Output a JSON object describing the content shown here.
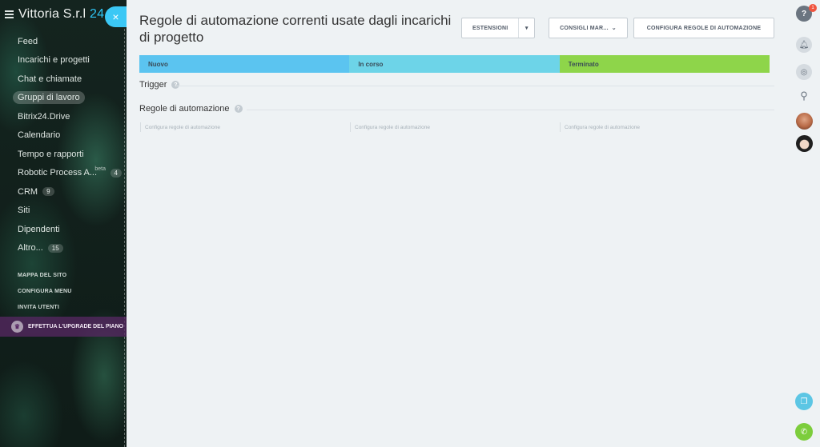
{
  "sidebar": {
    "logo": {
      "name": "Vittoria S.r.l",
      "suffix": "24"
    },
    "close_symbol": "×",
    "items": [
      {
        "label": "Feed"
      },
      {
        "label": "Incarichi e progetti"
      },
      {
        "label": "Chat e chiamate"
      },
      {
        "label": "Gruppi di lavoro"
      },
      {
        "label": "Bitrix24.Drive"
      },
      {
        "label": "Calendario"
      },
      {
        "label": "Tempo e rapporti"
      },
      {
        "label": "Robotic Process A...",
        "beta": "beta",
        "count": "4"
      },
      {
        "label": "CRM",
        "count": "9"
      },
      {
        "label": "Siti"
      },
      {
        "label": "Dipendenti"
      },
      {
        "label": "Altro...",
        "count": "15"
      }
    ],
    "admin": [
      "MAPPA DEL SITO",
      "CONFIGURA MENU",
      "INVITA UTENTI"
    ],
    "upgrade_label": "EFFETTUA L'UPGRADE DEL PIANO"
  },
  "main": {
    "title": "Regole di automazione correnti usate dagli incarichi di progetto",
    "buttons": {
      "extensions": "ESTENSIONI",
      "tips": "CONSIGLI MAR...",
      "configure": "CONFIGURA REGOLE DI AUTOMAZIONE"
    },
    "stages": [
      "Nuovo",
      "In corso",
      "Terminato"
    ],
    "stage_colors": [
      "#5bc4f0",
      "#6dd4e8",
      "#8ed54a"
    ],
    "trigger_label": "Trigger",
    "rules_label": "Regole di automazione",
    "config_link": "Configura regole di automazione"
  },
  "rail": {
    "help_badge": "1"
  },
  "icons": {
    "hamburger": "menu-icon",
    "help": "help-icon",
    "bell": "bell-icon",
    "chat": "chat-icon",
    "search": "search-icon"
  }
}
